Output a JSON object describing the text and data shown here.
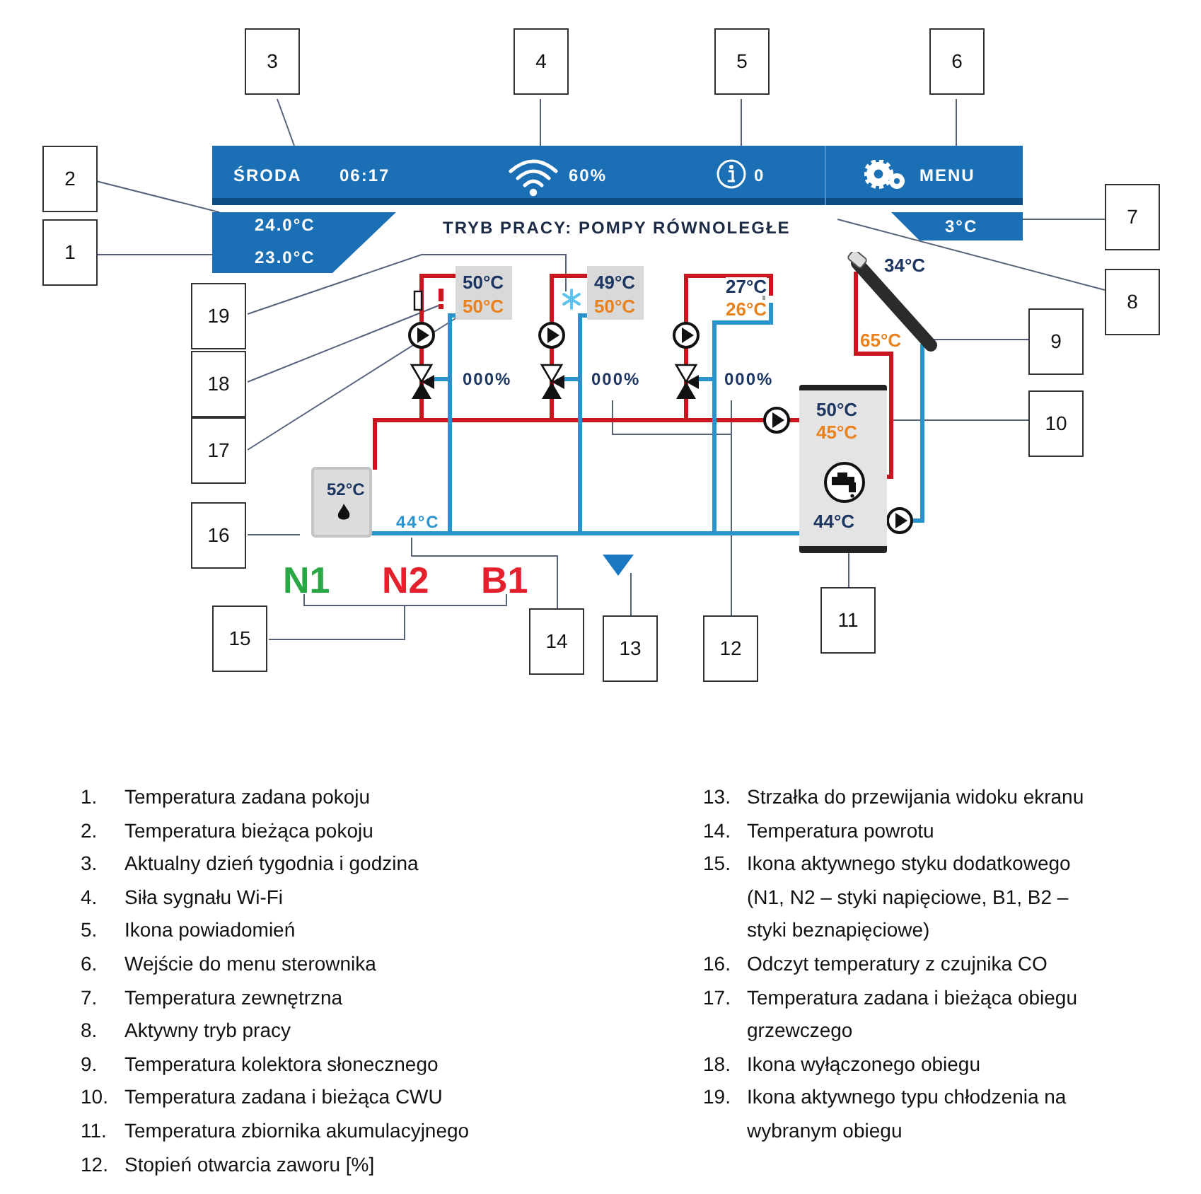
{
  "header": {
    "day": "ŚRODA",
    "time": "06:17",
    "wifi_signal": "60%",
    "notifications": "0",
    "menu": "MENU"
  },
  "room": {
    "current_temp": "24.0°C",
    "set_temp": "23.0°C"
  },
  "mode": "TRYB PRACY: POMPY RÓWNOLEGŁE",
  "outdoor_temp": "3°C",
  "circuits": [
    {
      "kind": "radiator",
      "off": true,
      "cooling": false,
      "current_temp": "50°C",
      "set_temp": "50°C",
      "valve_opening": "000%"
    },
    {
      "kind": "radiator",
      "off": false,
      "cooling": true,
      "current_temp": "49°C",
      "set_temp": "50°C",
      "valve_opening": "000%"
    },
    {
      "kind": "underfloor",
      "off": false,
      "cooling": false,
      "current_temp": "27°C",
      "set_temp": "26°C",
      "valve_opening": "000%"
    }
  ],
  "solar": {
    "collector_temp": "34°C",
    "outlet_temp": "65°C"
  },
  "dhw": {
    "current_temp": "50°C",
    "set_temp": "45°C",
    "tank_temp": "44°C"
  },
  "boiler_temp": "52°C",
  "return_temp": "44°C",
  "contacts": [
    {
      "label": "N1",
      "color": "#2aa846"
    },
    {
      "label": "N2",
      "color": "#e3202b"
    },
    {
      "label": "B1",
      "color": "#e3202b"
    }
  ],
  "callouts": [
    "3",
    "4",
    "5",
    "6",
    "2",
    "7",
    "1",
    "8",
    "19",
    "9",
    "18",
    "10",
    "17",
    "16",
    "15",
    "14",
    "13",
    "12",
    "11"
  ],
  "legend": {
    "column_1": [
      {
        "number": "1.",
        "text": "Temperatura zadana pokoju"
      },
      {
        "number": "2.",
        "text": "Temperatura bieżąca pokoju"
      },
      {
        "number": "3.",
        "text": "Aktualny dzień tygodnia i godzina"
      },
      {
        "number": "4.",
        "text": "Siła sygnału Wi-Fi"
      },
      {
        "number": "5.",
        "text": "Ikona powiadomień"
      },
      {
        "number": "6.",
        "text": "Wejście do menu sterownika"
      },
      {
        "number": "7.",
        "text": "Temperatura zewnętrzna"
      },
      {
        "number": "8.",
        "text": "Aktywny tryb pracy"
      },
      {
        "number": "9.",
        "text": "Temperatura kolektora słonecznego"
      },
      {
        "number": "10.",
        "text": "Temperatura zadana i bieżąca CWU"
      },
      {
        "number": "11.",
        "text": "Temperatura zbiornika akumulacyjnego"
      },
      {
        "number": "12.",
        "text": "Stopień otwarcia zaworu [%]"
      }
    ],
    "column_2": [
      {
        "number": "13.",
        "text": "Strzałka do przewijania widoku ekranu"
      },
      {
        "number": "14.",
        "text": "Temperatura powrotu"
      },
      {
        "number": "15.",
        "text": "Ikona aktywnego styku dodatkowego (N1, N2 – styki napięciowe, B1, B2 – styki beznapięciowe)"
      },
      {
        "number": "16.",
        "text": "Odczyt temperatury z czujnika CO"
      },
      {
        "number": "17.",
        "text": "Temperatura zadana i bieżąca obiegu grzewczego"
      },
      {
        "number": "18.",
        "text": "Ikona wyłączonego obiegu"
      },
      {
        "number": "19.",
        "text": "Ikona aktywnego typu chłodzenia na wybranym obiegu"
      }
    ]
  }
}
